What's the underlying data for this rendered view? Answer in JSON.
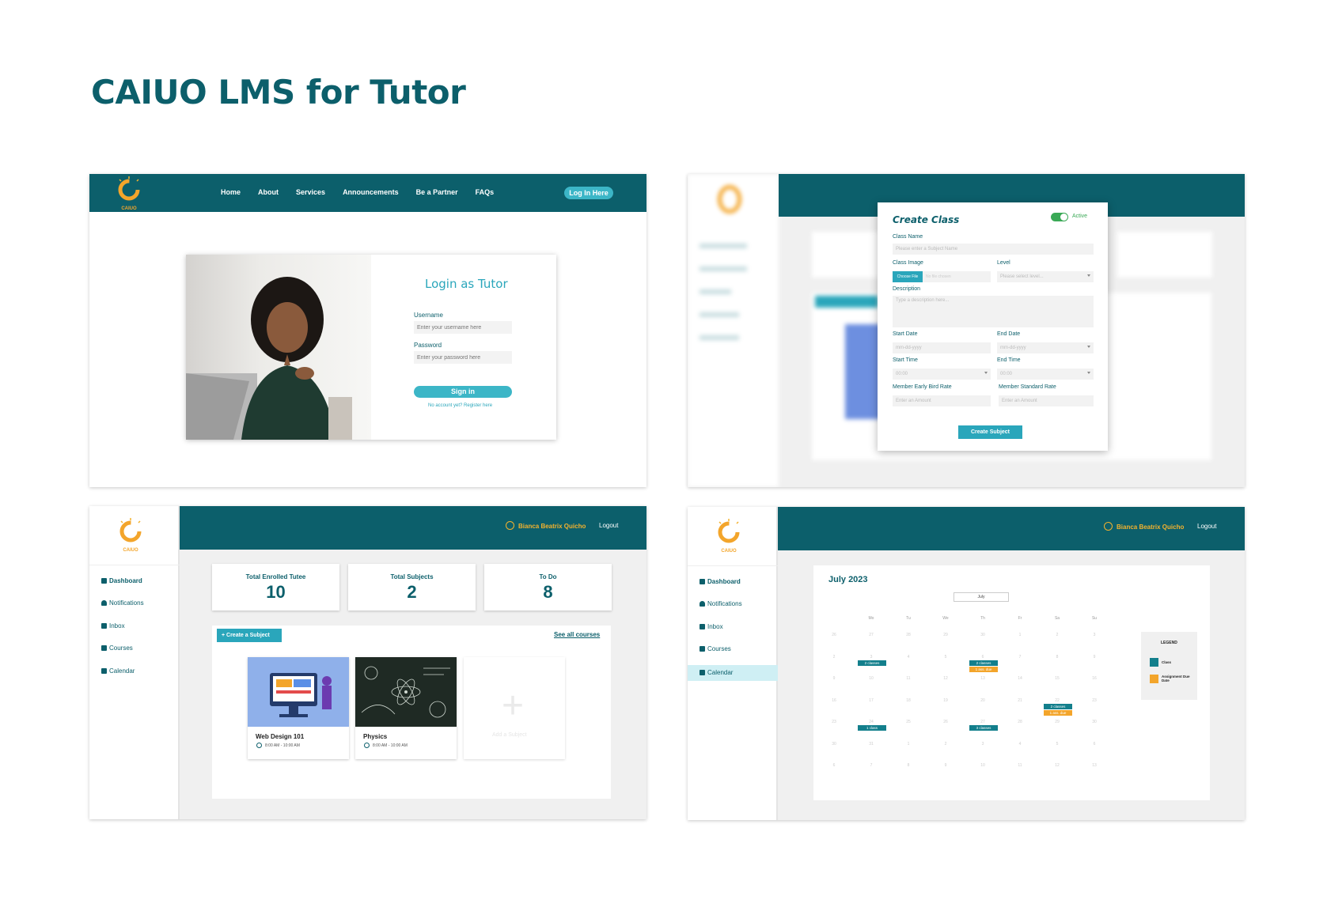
{
  "page_title": "CAIUO LMS for Tutor",
  "colors": {
    "teal": "#0c5f6b",
    "accent": "#2aa6bb",
    "gold": "#f3b22e",
    "orange": "#f3a52b",
    "green": "#3aa956"
  },
  "logo_text": "CAIUO",
  "landing": {
    "nav": [
      "Home",
      "About",
      "Services",
      "Announcements",
      "Be a Partner",
      "FAQs"
    ],
    "login_button": "Log In Here",
    "heading": "Login as Tutor",
    "username_label": "Username",
    "username_placeholder": "Enter your username here",
    "password_label": "Password",
    "password_placeholder": "Enter your password here",
    "signin": "Sign in",
    "register": "No account yet? Register here"
  },
  "create_class": {
    "title": "Create Class",
    "status": "Active",
    "class_name_label": "Class Name",
    "class_name_placeholder": "Please enter a Subject Name",
    "class_image_label": "Class Image",
    "choose_file": "Choose File",
    "no_file": "No file chosen",
    "level_label": "Level",
    "level_placeholder": "Please select level...",
    "description_label": "Description",
    "description_placeholder": "Type a description here...",
    "start_date_label": "Start Date",
    "start_date_placeholder": "mm-dd-yyyy",
    "end_date_label": "End Date",
    "end_date_placeholder": "mm-dd-yyyy",
    "start_time_label": "Start Time",
    "start_time_placeholder": "00:00",
    "end_time_label": "End Time",
    "end_time_placeholder": "00:00",
    "early_rate_label": "Member Early Bird Rate",
    "early_rate_placeholder": "Enter an Amount",
    "standard_rate_label": "Member Standard Rate",
    "standard_rate_placeholder": "Enter an Amount",
    "submit": "Create Subject"
  },
  "sidebar": [
    "Dashboard",
    "Notifications",
    "Inbox",
    "Courses",
    "Calendar"
  ],
  "user_name": "Bianca Beatrix Quicho",
  "logout": "Logout",
  "dashboard": {
    "stats": [
      {
        "label": "Total Enrolled Tutee",
        "value": "10"
      },
      {
        "label": "Total Subjects",
        "value": "2"
      },
      {
        "label": "To Do",
        "value": "8"
      }
    ],
    "create_subject": "+ Create a Subject",
    "see_all": "See all courses",
    "courses": [
      {
        "name": "Web Design 101",
        "time": "8:00 AM - 10:00 AM"
      },
      {
        "name": "Physics",
        "time": "8:00 AM - 10:00 AM"
      }
    ],
    "add_subject": "Add a Subject"
  },
  "calendar": {
    "title": "July 2023",
    "month_select": "July",
    "days": [
      "Mo",
      "Tu",
      "We",
      "Th",
      "Fr",
      "Sa",
      "Su"
    ],
    "weeks": [
      [
        "26",
        "27",
        "28",
        "29",
        "30",
        "1",
        "2",
        "3"
      ],
      [
        "2",
        "3",
        "4",
        "5",
        "6",
        "7",
        "8",
        "9"
      ],
      [
        "9",
        "10",
        "11",
        "12",
        "13",
        "14",
        "15",
        "16"
      ],
      [
        "16",
        "17",
        "18",
        "19",
        "20",
        "21",
        "22",
        "23"
      ],
      [
        "23",
        "24",
        "25",
        "26",
        "27",
        "28",
        "29",
        "30"
      ],
      [
        "30",
        "31",
        "1",
        "2",
        "3",
        "4",
        "5",
        "6"
      ],
      [
        "6",
        "7",
        "8",
        "9",
        "10",
        "11",
        "12",
        "13"
      ]
    ],
    "events": [
      {
        "label": "2 classes",
        "row": 1,
        "col": 1,
        "type": "class"
      },
      {
        "label": "2 classes",
        "row": 1,
        "col": 4,
        "type": "class"
      },
      {
        "label": "1 ass. due",
        "row": 1,
        "col": 4,
        "type": "due"
      },
      {
        "label": "2 classes",
        "row": 3,
        "col": 6,
        "type": "class"
      },
      {
        "label": "1 ass. due",
        "row": 3,
        "col": 6,
        "type": "due"
      },
      {
        "label": "1 class",
        "row": 4,
        "col": 1,
        "type": "class"
      },
      {
        "label": "3 classes",
        "row": 4,
        "col": 4,
        "type": "class"
      }
    ],
    "legend_title": "LEGEND",
    "legend": [
      {
        "label": "Class",
        "color": "#137f8c"
      },
      {
        "label": "Assignment Due Date",
        "color": "#f3a52b"
      }
    ]
  }
}
